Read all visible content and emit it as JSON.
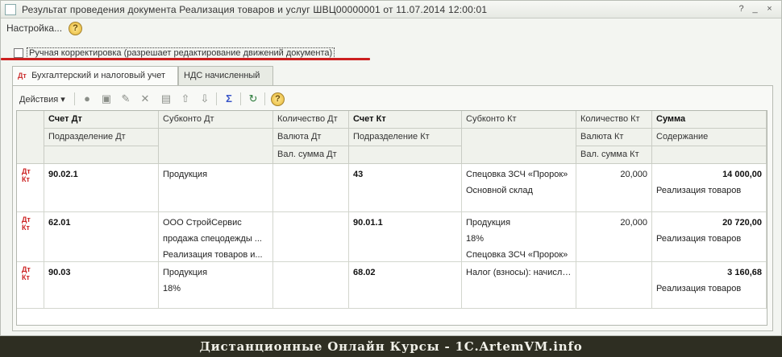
{
  "window": {
    "title": "Результат проведения документа Реализация товаров и услуг ШВЦ00000001 от 11.07.2014 12:00:01",
    "controls": {
      "help": "?",
      "minimize": "_",
      "close": "×"
    }
  },
  "menu": {
    "settings_label": "Настройка...",
    "help": "?"
  },
  "manual_correction": {
    "label": "Ручная корректировка (разрешает редактирование движений документа)",
    "checked": false
  },
  "tabs": [
    {
      "label": "Бухгалтерский и налоговый учет",
      "active": true,
      "icon": "accounting-icon"
    },
    {
      "label": "НДС начисленный",
      "active": false
    }
  ],
  "toolbar": {
    "actions_label": "Действия",
    "icons": [
      "add-icon",
      "copy-icon",
      "edit-icon",
      "delete-icon",
      "table-icon",
      "move-up-icon",
      "move-down-icon",
      "sum-icon",
      "refresh-icon",
      "help-icon"
    ]
  },
  "grid": {
    "headers": {
      "row1": [
        "Счет Дт",
        "Субконто Дт",
        "Количество Дт",
        "Счет Кт",
        "Субконто Кт",
        "Количество Кт",
        "Сумма"
      ],
      "row2": [
        "Подразделение Дт",
        "Валюта Дт",
        "Подразделение Кт",
        "Валюта Кт",
        "Содержание"
      ],
      "row3": [
        "Вал. сумма Дт",
        "Вал. сумма Кт"
      ]
    },
    "rows": [
      {
        "acc_dt": "90.02.1",
        "sub_dt": [
          "Продукция"
        ],
        "qty_dt": "",
        "acc_kt": "43",
        "sub_kt": [
          "Спецовка ЗСЧ «Пророк»",
          "Основной склад"
        ],
        "qty_kt": "20,000",
        "sum": "14 000,00",
        "content": "Реализация товаров"
      },
      {
        "acc_dt": "62.01",
        "sub_dt": [
          "ООО СтройСервис",
          "продажа спецодежды ...",
          "Реализация товаров и..."
        ],
        "qty_dt": "",
        "acc_kt": "90.01.1",
        "sub_kt": [
          "Продукция",
          "18%",
          "Спецовка ЗСЧ «Пророк»"
        ],
        "qty_kt": "20,000",
        "sum": "20 720,00",
        "content": "Реализация товаров"
      },
      {
        "acc_dt": "90.03",
        "sub_dt": [
          "Продукция",
          "18%"
        ],
        "qty_dt": "",
        "acc_kt": "68.02",
        "sub_kt": [
          "Налог (взносы): начисле..."
        ],
        "qty_kt": "",
        "sum": "3 160,68",
        "content": "Реализация товаров"
      }
    ]
  },
  "banner": {
    "text": "Дистанционные Онлайн Курсы - 1С.ArtemVM.info"
  },
  "colors": {
    "highlight_underline": "#cc1f1f",
    "banner_bg": "#2e2e22"
  }
}
